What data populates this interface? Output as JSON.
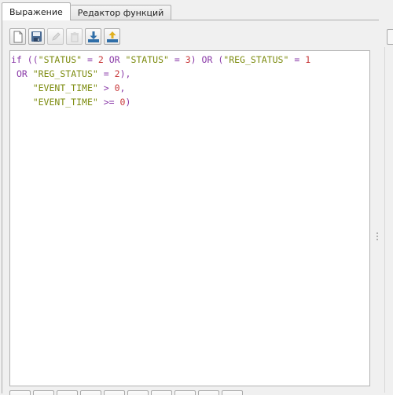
{
  "tabs": [
    {
      "label": "Выражение",
      "active": true
    },
    {
      "label": "Редактор функций",
      "active": false
    }
  ],
  "toolbar": {
    "buttons": [
      {
        "icon": "new-file-icon",
        "enabled": true
      },
      {
        "icon": "save-icon",
        "enabled": true
      },
      {
        "icon": "edit-icon",
        "enabled": false
      },
      {
        "icon": "delete-icon",
        "enabled": false
      },
      {
        "icon": "import-icon",
        "enabled": true
      },
      {
        "icon": "export-icon",
        "enabled": true
      }
    ]
  },
  "editor": {
    "lines": [
      [
        {
          "t": "kw",
          "v": "if"
        },
        {
          "t": "sp",
          "v": " "
        },
        {
          "t": "pn",
          "v": "(("
        },
        {
          "t": "fld",
          "v": "\"STATUS\""
        },
        {
          "t": "sp",
          "v": " "
        },
        {
          "t": "op",
          "v": "="
        },
        {
          "t": "sp",
          "v": " "
        },
        {
          "t": "num",
          "v": "2"
        },
        {
          "t": "sp",
          "v": " "
        },
        {
          "t": "kw",
          "v": "OR"
        },
        {
          "t": "sp",
          "v": " "
        },
        {
          "t": "fld",
          "v": "\"STATUS\""
        },
        {
          "t": "sp",
          "v": " "
        },
        {
          "t": "op",
          "v": "="
        },
        {
          "t": "sp",
          "v": " "
        },
        {
          "t": "num",
          "v": "3"
        },
        {
          "t": "pn",
          "v": ")"
        },
        {
          "t": "sp",
          "v": " "
        },
        {
          "t": "kw",
          "v": "OR"
        },
        {
          "t": "sp",
          "v": " "
        },
        {
          "t": "pn",
          "v": "("
        },
        {
          "t": "fld",
          "v": "\"REG_STATUS\""
        },
        {
          "t": "sp",
          "v": " "
        },
        {
          "t": "op",
          "v": "="
        },
        {
          "t": "sp",
          "v": " "
        },
        {
          "t": "num",
          "v": "1"
        }
      ],
      [
        {
          "t": "sp",
          "v": " "
        },
        {
          "t": "kw",
          "v": "OR"
        },
        {
          "t": "sp",
          "v": " "
        },
        {
          "t": "fld",
          "v": "\"REG_STATUS\""
        },
        {
          "t": "sp",
          "v": " "
        },
        {
          "t": "op",
          "v": "="
        },
        {
          "t": "sp",
          "v": " "
        },
        {
          "t": "num",
          "v": "2"
        },
        {
          "t": "pn",
          "v": "),"
        }
      ],
      [
        {
          "t": "sp",
          "v": "    "
        },
        {
          "t": "fld",
          "v": "\"EVENT_TIME\""
        },
        {
          "t": "sp",
          "v": " "
        },
        {
          "t": "op",
          "v": ">"
        },
        {
          "t": "sp",
          "v": " "
        },
        {
          "t": "num",
          "v": "0"
        },
        {
          "t": "pn",
          "v": ","
        }
      ],
      [
        {
          "t": "sp",
          "v": "    "
        },
        {
          "t": "fld",
          "v": "\"EVENT_TIME\""
        },
        {
          "t": "sp",
          "v": " "
        },
        {
          "t": "op",
          "v": ">="
        },
        {
          "t": "sp",
          "v": " "
        },
        {
          "t": "num",
          "v": "0"
        },
        {
          "t": "pn",
          "v": ")"
        }
      ]
    ]
  },
  "colors": {
    "keyword": "#8a3aa8",
    "field": "#7d8c10",
    "number": "#c8393b",
    "save_icon": "#4a6b94",
    "import_export_icon": "#2f6ea8",
    "export_arrow": "#e0b020"
  }
}
